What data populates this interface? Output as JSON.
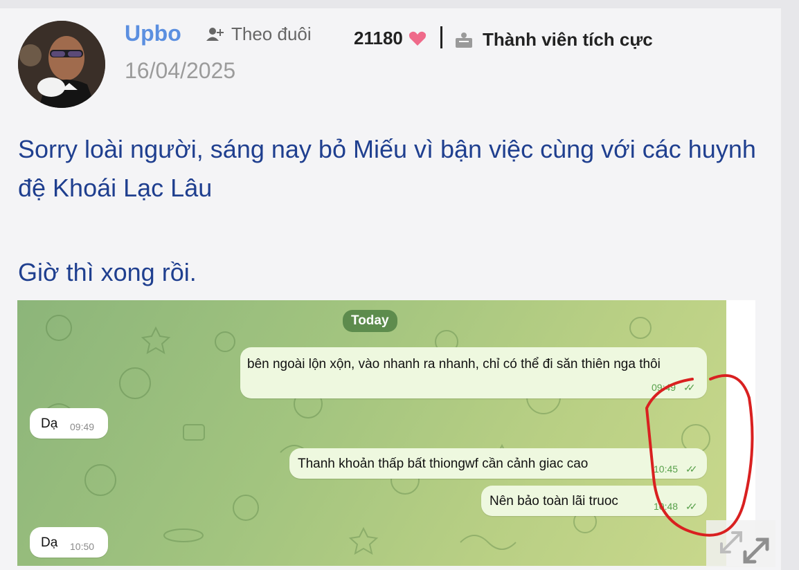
{
  "post": {
    "username": "Upbo",
    "follow_label": "Theo đuôi",
    "likes": "21180",
    "rank": "Thành viên tích cực",
    "date": "16/04/2025",
    "paragraph1": "Sorry loài người, sáng nay bỏ Miếu vì bận việc cùng với các huynh đệ Khoái Lạc Lâu",
    "paragraph2": "Giờ thì xong rồi."
  },
  "chat": {
    "day_label": "Today",
    "messages": [
      {
        "text": "bên ngoài lộn xộn, vào nhanh ra nhanh, chỉ có thể đi săn thiên nga thôi",
        "time": "09:49"
      },
      {
        "text": "Dạ",
        "time": "09:49"
      },
      {
        "text": "Thanh khoản thấp bất thiongwf cần cảnh giac cao",
        "time": "10:45"
      },
      {
        "text": "Nên bảo toàn lãi truoc",
        "time": "10:48"
      },
      {
        "text": "Dạ",
        "time": "10:50"
      }
    ]
  },
  "icons": {
    "follow": "add-user-icon",
    "like": "heart-icon",
    "rank": "badge-icon",
    "expand": "expand-icon",
    "read": "double-check-icon"
  },
  "colors": {
    "username": "#5b8fe0",
    "body_text": "#1f3f8f",
    "heart": "#ef6a8a",
    "annotation": "#d92020"
  }
}
